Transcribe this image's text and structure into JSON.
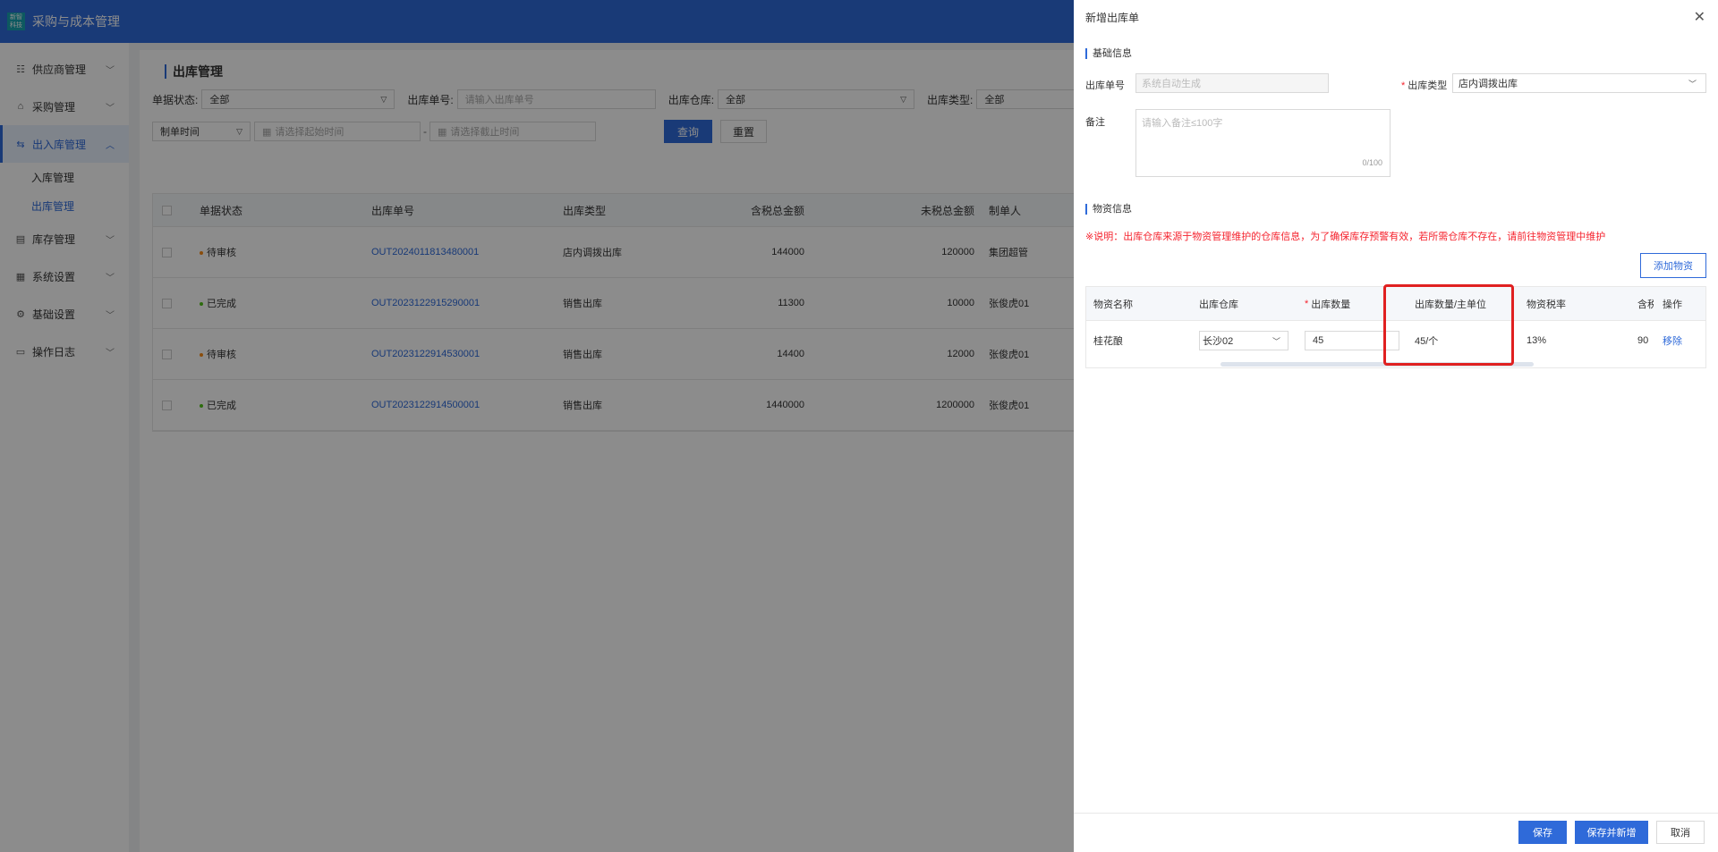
{
  "app": {
    "logo_text": "新智\n科技",
    "title": "采购与成本管理"
  },
  "sidebar": {
    "items": [
      {
        "label": "供应商管理",
        "icon": "supplier-icon",
        "glyph": "☷"
      },
      {
        "label": "采购管理",
        "icon": "purchase-icon",
        "glyph": "⌂"
      },
      {
        "label": "出入库管理",
        "icon": "warehouse-io-icon",
        "glyph": "⇆",
        "active": true
      },
      {
        "label": "库存管理",
        "icon": "inventory-icon",
        "glyph": "▤"
      },
      {
        "label": "系统设置",
        "icon": "system-icon",
        "glyph": "▦"
      },
      {
        "label": "基础设置",
        "icon": "settings-icon",
        "glyph": "⚙"
      },
      {
        "label": "操作日志",
        "icon": "log-icon",
        "glyph": "▭"
      }
    ],
    "sub_items": [
      {
        "label": "入库管理"
      },
      {
        "label": "出库管理",
        "active": true
      }
    ]
  },
  "main": {
    "title": "出库管理",
    "filters": {
      "status_label": "单据状态:",
      "status_value": "全部",
      "order_no_label": "出库单号:",
      "order_no_placeholder": "请输入出库单号",
      "warehouse_label": "出库仓库:",
      "warehouse_value": "全部",
      "type_label": "出库类型:",
      "type_value": "全部",
      "time_type_value": "制单时间",
      "start_placeholder": "请选择起始时间",
      "range_sep": "-",
      "end_placeholder": "请选择截止时间",
      "query_label": "查询",
      "reset_label": "重置"
    },
    "table": {
      "headers": [
        "单据状态",
        "出库单号",
        "出库类型",
        "含税总金额",
        "未税总金额",
        "制单人"
      ],
      "rows": [
        {
          "status": "待审核",
          "status_color": "#fa8c16",
          "order_no": "OUT2024011813480001",
          "type": "店内调拨出库",
          "tax_total": "144000",
          "untaxed_total": "120000",
          "creator": "集团超管"
        },
        {
          "status": "已完成",
          "status_color": "#52c41a",
          "order_no": "OUT2023122915290001",
          "type": "销售出库",
          "tax_total": "11300",
          "untaxed_total": "10000",
          "creator": "张俊虎01"
        },
        {
          "status": "待审核",
          "status_color": "#fa8c16",
          "order_no": "OUT2023122914530001",
          "type": "销售出库",
          "tax_total": "14400",
          "untaxed_total": "12000",
          "creator": "张俊虎01"
        },
        {
          "status": "已完成",
          "status_color": "#52c41a",
          "order_no": "OUT2023122914500001",
          "type": "销售出库",
          "tax_total": "1440000",
          "untaxed_total": "1200000",
          "creator": "张俊虎01"
        }
      ]
    }
  },
  "drawer": {
    "title": "新增出库单",
    "basic_section": "基础信息",
    "order_no_label": "出库单号",
    "order_no_placeholder": "系统自动生成",
    "type_label": "出库类型",
    "type_value": "店内调拨出库",
    "remark_label": "备注",
    "remark_placeholder": "请输入备注≤100字",
    "remark_count": "0/100",
    "material_section": "物资信息",
    "note": "※说明：出库仓库来源于物资管理维护的仓库信息，为了确保库存预警有效，若所需仓库不存在，请前往物资管理中维护",
    "add_button": "添加物资",
    "table": {
      "headers": {
        "name": "物资名称",
        "warehouse": "出库仓库",
        "qty": "出库数量",
        "qty_unit": "出库数量/主单位",
        "tax_rate": "物资税率",
        "tax_incl": "含税",
        "action": "操作"
      },
      "row": {
        "name": "桂花酿",
        "warehouse": "长沙02",
        "qty": "45",
        "qty_unit": "45/个",
        "tax_rate": "13%",
        "tax_incl": "90",
        "action": "移除"
      }
    },
    "footer": {
      "save": "保存",
      "save_new": "保存并新增",
      "cancel": "取消"
    }
  },
  "colors": {
    "brand": "#2f6ad9",
    "highlight": "#e02020",
    "required": "#f5222d"
  }
}
